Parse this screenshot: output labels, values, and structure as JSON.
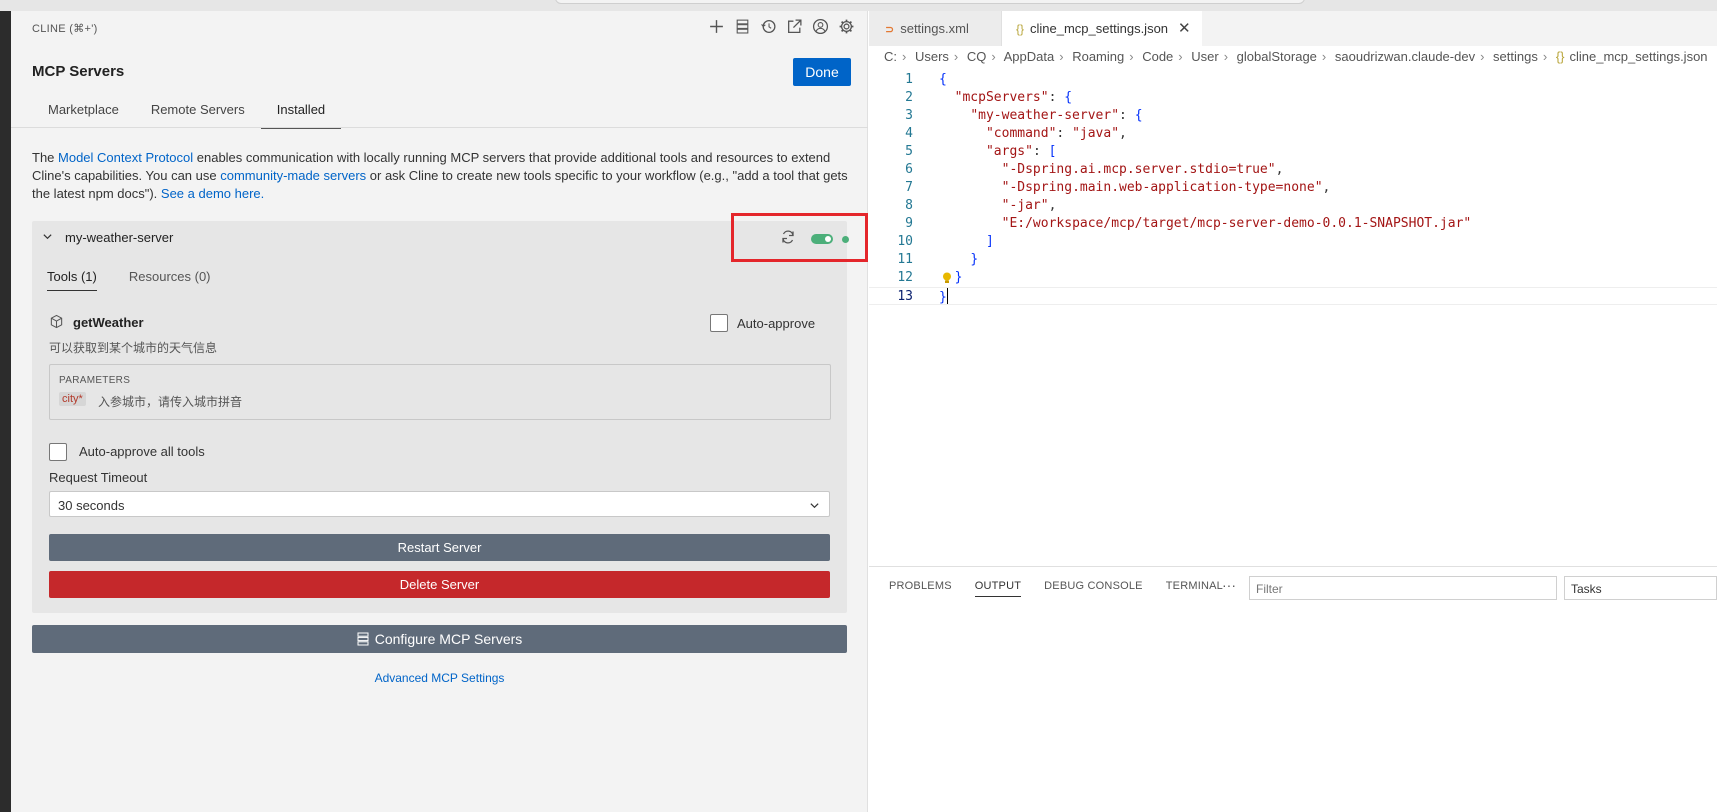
{
  "sidebar": {
    "title": "CLINE (⌘+')",
    "toolbar_icons": [
      "plus-icon",
      "server-icon",
      "history-icon",
      "open-external-icon",
      "account-icon",
      "gear-icon"
    ],
    "heading": "MCP Servers",
    "done_label": "Done",
    "tabs": [
      {
        "label": "Marketplace"
      },
      {
        "label": "Remote Servers"
      },
      {
        "label": "Installed"
      }
    ],
    "intro": {
      "t1": "The ",
      "link1": "Model Context Protocol",
      "t2": " enables communication with locally running MCP servers that provide additional tools and resources to extend Cline's capabilities. You can use ",
      "link2": "community-made servers",
      "t3": " or ask Cline to create new tools specific to your workflow (e.g., \"add a tool that gets the latest npm docs\"). ",
      "link3": "See a demo here."
    },
    "server": {
      "name": "my-weather-server",
      "enabled": true,
      "status_color": "#4caf7a",
      "subtabs": [
        {
          "label": "Tools (1)"
        },
        {
          "label": "Resources (0)"
        }
      ],
      "tool": {
        "name": "getWeather",
        "description": "可以获取到某个城市的天气信息",
        "auto_approve_label": "Auto-approve",
        "auto_approve_checked": false,
        "params_title": "PARAMETERS",
        "param_name": "city*",
        "param_desc": "入参城市，请传入城市拼音"
      },
      "auto_approve_all_label": "Auto-approve all tools",
      "timeout_label": "Request Timeout",
      "timeout_value": "30 seconds",
      "restart_label": "Restart Server",
      "delete_label": "Delete Server"
    },
    "configure_label": "Configure MCP Servers",
    "advanced_label": "Advanced MCP Settings"
  },
  "editor": {
    "tabs": [
      {
        "label": "settings.xml",
        "icon": "rss-xml-icon"
      },
      {
        "label": "cline_mcp_settings.json",
        "icon": "json-braces-icon",
        "active": true
      }
    ],
    "breadcrumb": [
      "C:",
      "Users",
      "CQ",
      "AppData",
      "Roaming",
      "Code",
      "User",
      "globalStorage",
      "saoudrizwan.claude-dev",
      "settings",
      "cline_mcp_settings.json"
    ],
    "line_numbers": [
      "1",
      "2",
      "3",
      "4",
      "5",
      "6",
      "7",
      "8",
      "9",
      "10",
      "11",
      "12",
      "13"
    ],
    "code": {
      "l2_key": "\"mcpServers\"",
      "l3_key": "\"my-weather-server\"",
      "l4_key": "\"command\"",
      "l4_val": "\"java\"",
      "l5_key": "\"args\"",
      "l6_val": "\"-Dspring.ai.mcp.server.stdio=true\"",
      "l7_val": "\"-Dspring.main.web-application-type=none\"",
      "l8_val": "\"-jar\"",
      "l9_val": "\"E:/workspace/mcp/target/mcp-server-demo-0.0.1-SNAPSHOT.jar\""
    },
    "panel": {
      "tabs": [
        {
          "label": "PROBLEMS"
        },
        {
          "label": "OUTPUT"
        },
        {
          "label": "DEBUG CONSOLE"
        },
        {
          "label": "TERMINAL"
        }
      ],
      "more": "···",
      "filter_placeholder": "Filter",
      "tasks_value": "Tasks"
    }
  },
  "colors": {
    "accent_blue": "#0064c8",
    "delete_red": "#c5282b",
    "highlight_red": "#e4262b",
    "status_green": "#4caf7a"
  }
}
